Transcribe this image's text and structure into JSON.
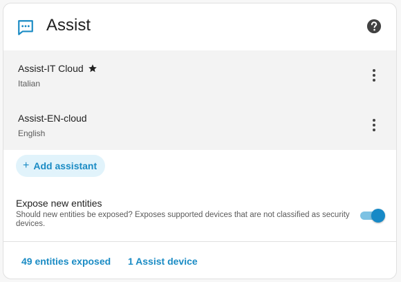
{
  "header": {
    "title": "Assist",
    "logo_icon": "chat-bubble-icon",
    "help_icon": "help-circle-icon"
  },
  "assistants": [
    {
      "name": "Assist-IT Cloud",
      "language": "Italian",
      "preferred": true
    },
    {
      "name": "Assist-EN-cloud",
      "language": "English",
      "preferred": false
    }
  ],
  "add_button": {
    "label": "Add assistant",
    "icon": "plus-icon"
  },
  "expose": {
    "title": "Expose new entities",
    "description": "Should new entities be exposed? Exposes supported devices that are not classified as security devices.",
    "enabled": true
  },
  "footer": {
    "entities_link": "49 entities exposed",
    "devices_link": "1 Assist device"
  },
  "colors": {
    "accent": "#1a8bc4",
    "list_background": "#f3f3f3",
    "add_button_background": "#e1f3fb"
  }
}
